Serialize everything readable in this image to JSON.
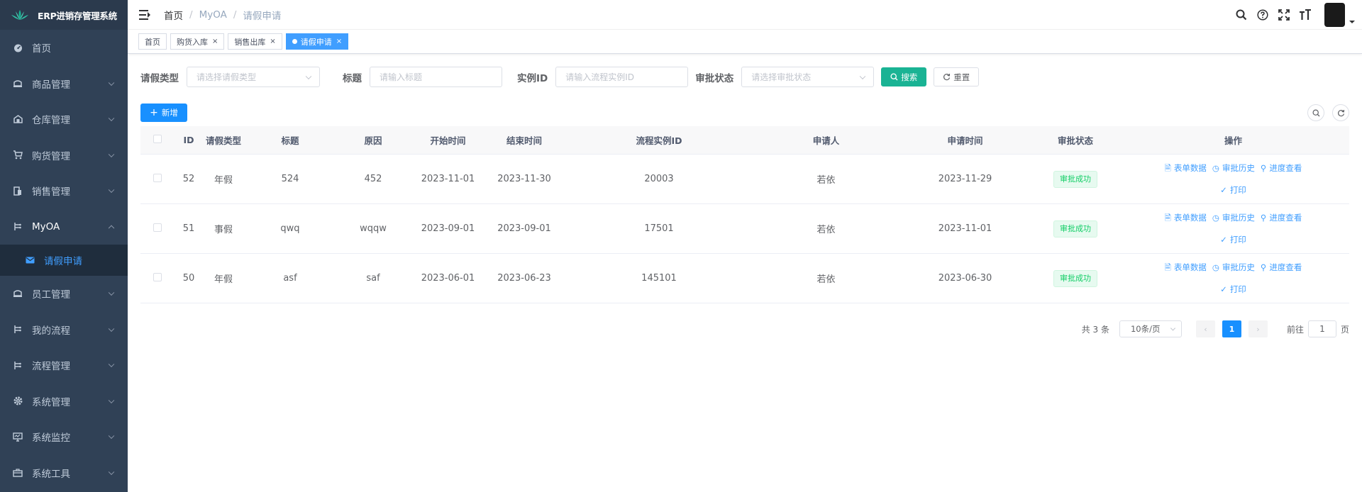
{
  "sidebar": {
    "logo_text": "ERP进销存管理系统",
    "items": [
      {
        "label": "首页",
        "icon": "dashboard-icon",
        "has_chevron": false
      },
      {
        "label": "商品管理",
        "icon": "goods-icon",
        "has_chevron": true
      },
      {
        "label": "仓库管理",
        "icon": "warehouse-icon",
        "has_chevron": true
      },
      {
        "label": "购货管理",
        "icon": "cart-icon",
        "has_chevron": true
      },
      {
        "label": "销售管理",
        "icon": "sales-icon",
        "has_chevron": true
      },
      {
        "label": "MyOA",
        "icon": "oa-icon",
        "has_chevron": true,
        "open": true
      },
      {
        "label": "员工管理",
        "icon": "employee-icon",
        "has_chevron": true
      },
      {
        "label": "我的流程",
        "icon": "process-icon",
        "has_chevron": true
      },
      {
        "label": "流程管理",
        "icon": "process-manage-icon",
        "has_chevron": true
      },
      {
        "label": "系统管理",
        "icon": "system-icon",
        "has_chevron": true
      },
      {
        "label": "系统监控",
        "icon": "monitor-icon",
        "has_chevron": true
      },
      {
        "label": "系统工具",
        "icon": "tool-icon",
        "has_chevron": true
      }
    ],
    "submenu_active": "请假申请"
  },
  "navbar": {
    "breadcrumb": [
      "首页",
      "MyOA",
      "请假申请"
    ],
    "separator": "/",
    "icons": [
      "search-icon",
      "help-icon",
      "fullscreen-icon",
      "font-size-icon"
    ]
  },
  "tags": [
    {
      "label": "首页",
      "closable": false,
      "active": false
    },
    {
      "label": "购货入库",
      "closable": true,
      "active": false
    },
    {
      "label": "销售出库",
      "closable": true,
      "active": false
    },
    {
      "label": "请假申请",
      "closable": true,
      "active": true
    }
  ],
  "search": {
    "leave_type_label": "请假类型",
    "leave_type_placeholder": "请选择请假类型",
    "title_label": "标题",
    "title_placeholder": "请输入标题",
    "instance_label": "实例ID",
    "instance_placeholder": "请输入流程实例ID",
    "status_label": "审批状态",
    "status_placeholder": "请选择审批状态",
    "search_btn": "搜索",
    "reset_btn": "重置"
  },
  "toolbar": {
    "add_btn": "新增"
  },
  "table": {
    "headers": [
      "ID",
      "请假类型",
      "标题",
      "原因",
      "开始时间",
      "结束时间",
      "流程实例ID",
      "申请人",
      "申请时间",
      "审批状态",
      "操作"
    ],
    "rows": [
      {
        "id": "52",
        "type": "年假",
        "title": "524",
        "reason": "452",
        "start": "2023-11-01",
        "end": "2023-11-30",
        "pid": "20003",
        "user": "若依",
        "apply_time": "2023-11-29",
        "status": "审批成功"
      },
      {
        "id": "51",
        "type": "事假",
        "title": "qwq",
        "reason": "wqqw",
        "start": "2023-09-01",
        "end": "2023-09-01",
        "pid": "17501",
        "user": "若依",
        "apply_time": "2023-11-01",
        "status": "审批成功"
      },
      {
        "id": "50",
        "type": "年假",
        "title": "asf",
        "reason": "saf",
        "start": "2023-06-01",
        "end": "2023-06-23",
        "pid": "145101",
        "user": "若依",
        "apply_time": "2023-06-30",
        "status": "审批成功"
      }
    ],
    "ops": {
      "form_data": "表单数据",
      "approval_history": "审批历史",
      "progress": "进度查看",
      "print": "打印"
    }
  },
  "pagination": {
    "total": "共 3 条",
    "page_size": "10条/页",
    "current_page": "1",
    "goto_prefix": "前往",
    "goto_value": "1",
    "goto_suffix": "页"
  },
  "colors": {
    "sidebar_bg": "#304156",
    "accent": "#409eff",
    "search_btn": "#1ab394",
    "success": "#13ce66"
  }
}
